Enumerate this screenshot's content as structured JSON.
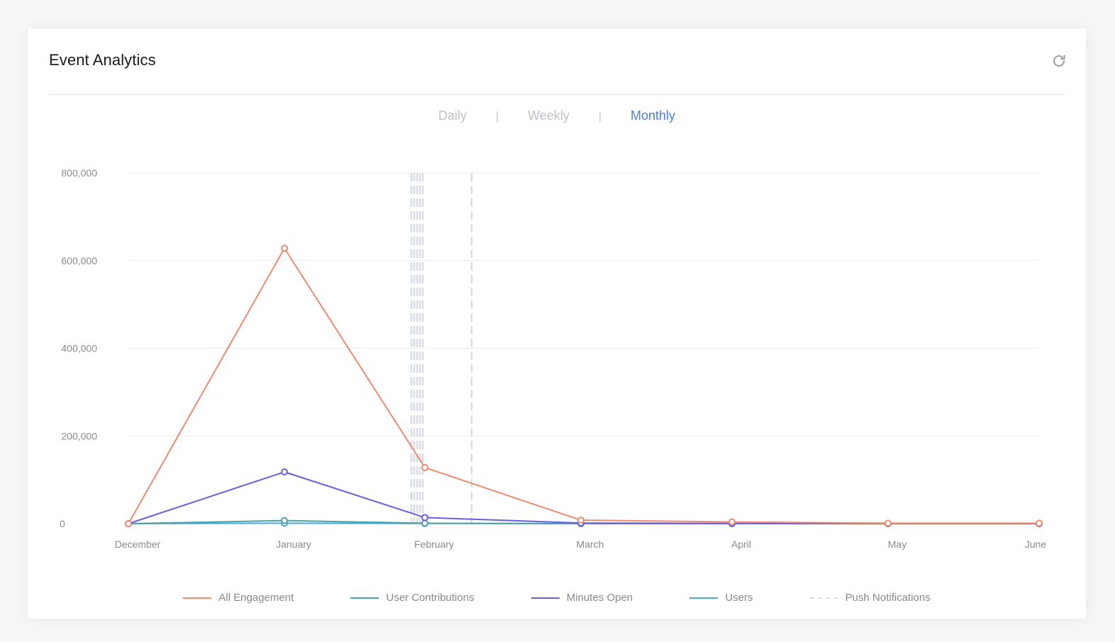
{
  "card": {
    "title": "Event Analytics"
  },
  "icons": {
    "refresh": "refresh-icon"
  },
  "tabs": [
    {
      "label": "Daily",
      "active": false
    },
    {
      "label": "Weekly",
      "active": false
    },
    {
      "label": "Monthly",
      "active": true
    }
  ],
  "tab_separator": "|",
  "colors": {
    "all_engagement": "#ef8a6f",
    "user_contributions": "#4aa3a8",
    "minutes_open": "#6a5ee0",
    "users": "#4da6dc",
    "push_notifications": "#d9dde3",
    "active_tab": "#4a7fd4"
  },
  "chart_data": {
    "type": "line",
    "title": "",
    "xlabel": "",
    "ylabel": "",
    "categories": [
      "December",
      "January",
      "February",
      "March",
      "April",
      "May",
      "June"
    ],
    "ylim": [
      0,
      800000
    ],
    "yticks": [
      "800,000",
      "600,000",
      "400,000",
      "200,000",
      "0"
    ],
    "ytick_values": [
      800000,
      600000,
      400000,
      200000,
      0
    ],
    "grid": true,
    "legend": "bottom",
    "series": [
      {
        "name": "All Engagement",
        "color": "#ef8a6f",
        "values": [
          0,
          628000,
          128000,
          8000,
          4000,
          1000,
          1000
        ]
      },
      {
        "name": "User Contributions",
        "color": "#4aa3a8",
        "values": [
          0,
          7000,
          1000,
          0,
          0,
          0,
          0
        ]
      },
      {
        "name": "Minutes Open",
        "color": "#6a5ee0",
        "values": [
          0,
          118000,
          14000,
          1500,
          500,
          200,
          100
        ]
      },
      {
        "name": "Users",
        "color": "#4da6dc",
        "values": [
          0,
          1000,
          500,
          200,
          100,
          50,
          50
        ]
      },
      {
        "name": "Push Notifications",
        "color": "#d9dde3",
        "dashed": true,
        "values": []
      }
    ]
  }
}
